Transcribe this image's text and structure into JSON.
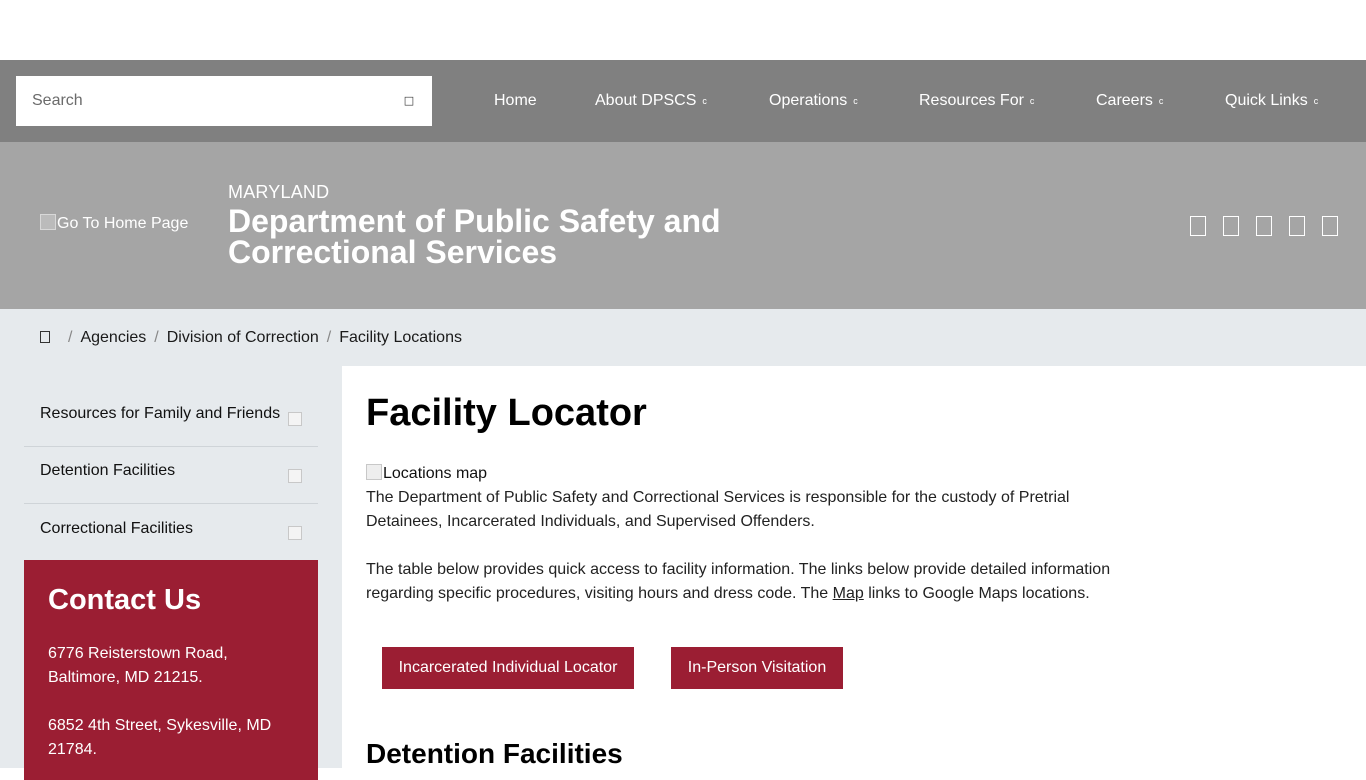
{
  "search": {
    "placeholder": "Search",
    "icon": "search-icon"
  },
  "nav": {
    "items": [
      {
        "label": "Home",
        "has_dropdown": false
      },
      {
        "label": "About DPSCS",
        "has_dropdown": true
      },
      {
        "label": "Operations",
        "has_dropdown": true
      },
      {
        "label": "Resources For",
        "has_dropdown": true
      },
      {
        "label": "Careers",
        "has_dropdown": true
      },
      {
        "label": "Quick Links",
        "has_dropdown": true
      }
    ],
    "caret_glyph": "c"
  },
  "header": {
    "logo_alt": "Go To Home Page",
    "state": "MARYLAND",
    "agency": "Department of Public Safety and Correctional Services",
    "social_icons": [
      "facebook-icon",
      "twitter-icon",
      "instagram-icon",
      "youtube-icon",
      "linkedin-icon"
    ]
  },
  "breadcrumb": {
    "items": [
      "Agencies",
      "Division of Correction",
      "Facility Locations"
    ],
    "separator": "/"
  },
  "sidebar": {
    "items": [
      {
        "label": "Resources for Family and Friends"
      },
      {
        "label": "Detention Facilities"
      },
      {
        "label": "Correctional Facilities"
      }
    ]
  },
  "contact": {
    "title": "Contact Us",
    "address1": "6776 Reisterstown Road, Baltimore, MD 21215.",
    "address2": "6852 4th Street, Sykesville, MD 21784."
  },
  "main": {
    "title": "Facility Locator",
    "map_alt": "Locations map",
    "intro": "The Department of Public Safety and Correctional Services is responsible for the custody of Pretrial Detainees, Incarcerated Individuals, and Supervised Offenders.",
    "para2_before": "The table below provides quick access to facility information. The links below provide detailed information regarding specific procedures, visiting hours and dress code. The ",
    "para2_link": "Map",
    "para2_after": " links to Google Maps locations.",
    "buttons": [
      "Incarcerated Individual Locator",
      "In-Person Visitation"
    ],
    "section_heading": "Detention Facilities"
  },
  "colors": {
    "nav_bg": "#808080",
    "header_bg": "#a5a5a5",
    "breadcrumb_bg": "#e6eaed",
    "accent": "#9b1e33"
  }
}
